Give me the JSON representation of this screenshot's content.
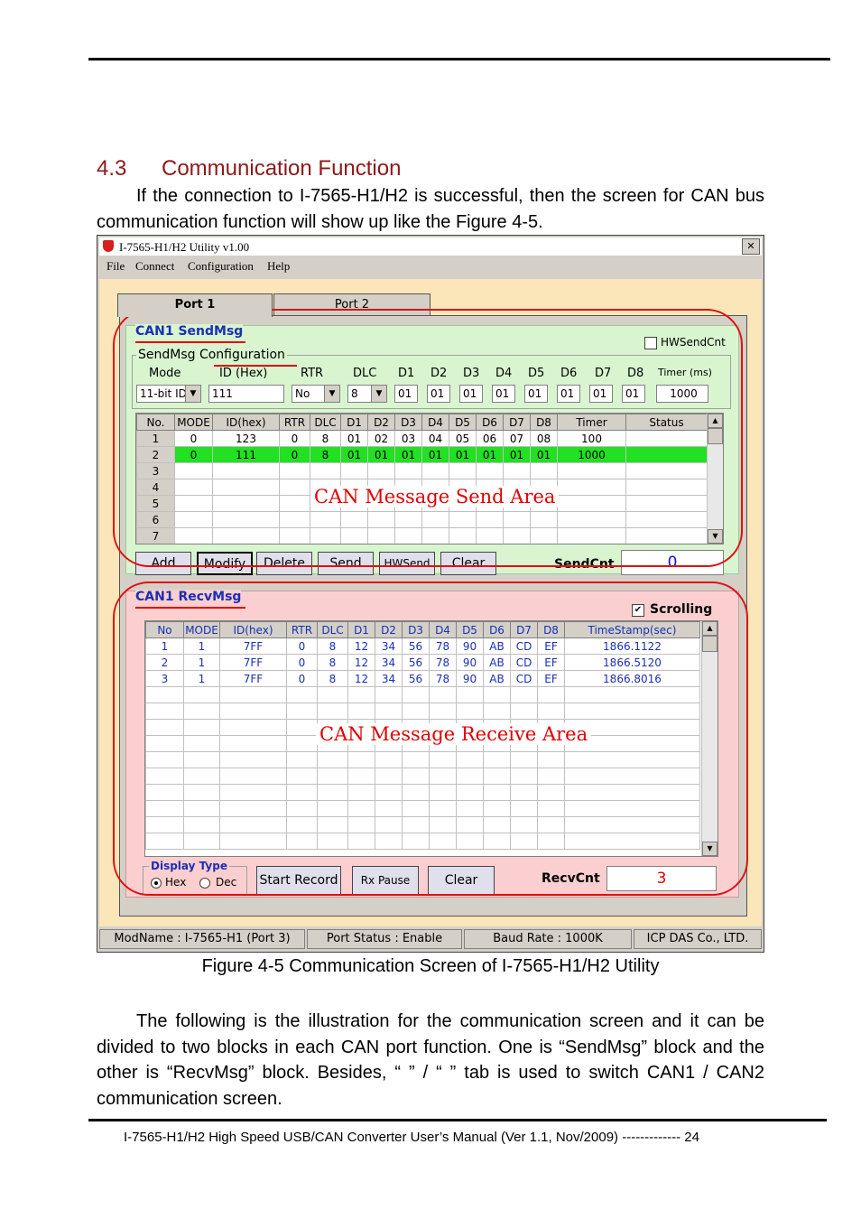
{
  "section": {
    "number": "4.3",
    "title": "Communication Function"
  },
  "intro": "If the connection to I-7565-H1/H2 is successful, then the screen for CAN bus communication function will show up like the Figure 4-5.",
  "window": {
    "title": "I-7565-H1/H2 Utility v1.00",
    "close": "✕",
    "menu": [
      "File",
      "Connect",
      "Configuration",
      "Help"
    ],
    "tabs": [
      "Port 1",
      "Port 2"
    ],
    "send": {
      "group_title": "CAN1 SendMsg",
      "hw_checkbox": "HWSendCnt",
      "config_title": "SendMsg Configuration",
      "labels": {
        "mode": "Mode",
        "id": "ID (Hex)",
        "rtr": "RTR",
        "dlc": "DLC",
        "d1": "D1",
        "d2": "D2",
        "d3": "D3",
        "d4": "D4",
        "d5": "D5",
        "d6": "D6",
        "d7": "D7",
        "d8": "D8",
        "timer": "Timer (ms)"
      },
      "values": {
        "mode": "11-bit ID",
        "id": "111",
        "rtr": "No",
        "dlc": "8",
        "d1": "01",
        "d2": "01",
        "d3": "01",
        "d4": "01",
        "d5": "01",
        "d6": "01",
        "d7": "01",
        "d8": "01",
        "timer": "1000"
      },
      "columns": [
        "No.",
        "MODE",
        "ID(hex)",
        "RTR",
        "DLC",
        "D1",
        "D2",
        "D3",
        "D4",
        "D5",
        "D6",
        "D7",
        "D8",
        "Timer",
        "Status"
      ],
      "rows": [
        [
          "1",
          "0",
          "123",
          "0",
          "8",
          "01",
          "02",
          "03",
          "04",
          "05",
          "06",
          "07",
          "08",
          "100",
          ""
        ],
        [
          "2",
          "0",
          "111",
          "0",
          "8",
          "01",
          "01",
          "01",
          "01",
          "01",
          "01",
          "01",
          "01",
          "1000",
          ""
        ],
        [
          "3",
          "",
          "",
          "",
          "",
          "",
          "",
          "",
          "",
          "",
          "",
          "",
          "",
          "",
          ""
        ],
        [
          "4",
          "",
          "",
          "",
          "",
          "",
          "",
          "",
          "",
          "",
          "",
          "",
          "",
          "",
          ""
        ],
        [
          "5",
          "",
          "",
          "",
          "",
          "",
          "",
          "",
          "",
          "",
          "",
          "",
          "",
          "",
          ""
        ],
        [
          "6",
          "",
          "",
          "",
          "",
          "",
          "",
          "",
          "",
          "",
          "",
          "",
          "",
          "",
          ""
        ],
        [
          "7",
          "",
          "",
          "",
          "",
          "",
          "",
          "",
          "",
          "",
          "",
          "",
          "",
          "",
          ""
        ]
      ],
      "area_label": "CAN Message Send Area",
      "buttons": [
        "Add",
        "Modify",
        "Delete",
        "Send",
        "HWSend",
        "Clear"
      ],
      "count_label": "SendCnt",
      "count_value": "0"
    },
    "recv": {
      "group_title": "CAN1 RecvMsg",
      "scrolling": "Scrolling",
      "columns": [
        "No",
        "MODE",
        "ID(hex)",
        "RTR",
        "DLC",
        "D1",
        "D2",
        "D3",
        "D4",
        "D5",
        "D6",
        "D7",
        "D8",
        "TimeStamp(sec)"
      ],
      "rows": [
        [
          "1",
          "1",
          "7FF",
          "0",
          "8",
          "12",
          "34",
          "56",
          "78",
          "90",
          "AB",
          "CD",
          "EF",
          "1866.1122"
        ],
        [
          "2",
          "1",
          "7FF",
          "0",
          "8",
          "12",
          "34",
          "56",
          "78",
          "90",
          "AB",
          "CD",
          "EF",
          "1866.5120"
        ],
        [
          "3",
          "1",
          "7FF",
          "0",
          "8",
          "12",
          "34",
          "56",
          "78",
          "90",
          "AB",
          "CD",
          "EF",
          "1866.8016"
        ]
      ],
      "area_label": "CAN Message Receive Area",
      "display_type": {
        "title": "Display Type",
        "hex": "Hex",
        "dec": "Dec"
      },
      "buttons": [
        "Start Record",
        "Rx Pause",
        "Clear"
      ],
      "count_label": "RecvCnt",
      "count_value": "3"
    },
    "status": [
      "ModName : I-7565-H1 (Port 3)",
      "Port Status : Enable",
      "Baud Rate : 1000K",
      "ICP DAS Co., LTD."
    ]
  },
  "caption": "Figure 4-5  Communication Screen of I-7565-H1/H2 Utility",
  "body_text": "The following is the illustration for the communication screen and it can be divided to two blocks in each CAN port function. One is “SendMsg” block and the other is “RecvMsg” block. Besides, “           ” / “           ” tab is used to switch CAN1 / CAN2 communication screen.",
  "footer": "I-7565-H1/H2 High Speed USB/CAN Converter User’s Manual (Ver 1.1, Nov/2009) ------------- 24",
  "colors": {
    "heading": "#8b1a1a",
    "send_bg": "#d8f5d0",
    "recv_bg": "#fbcfcf",
    "highlight": "#22e022",
    "annotation": "#e00000"
  }
}
